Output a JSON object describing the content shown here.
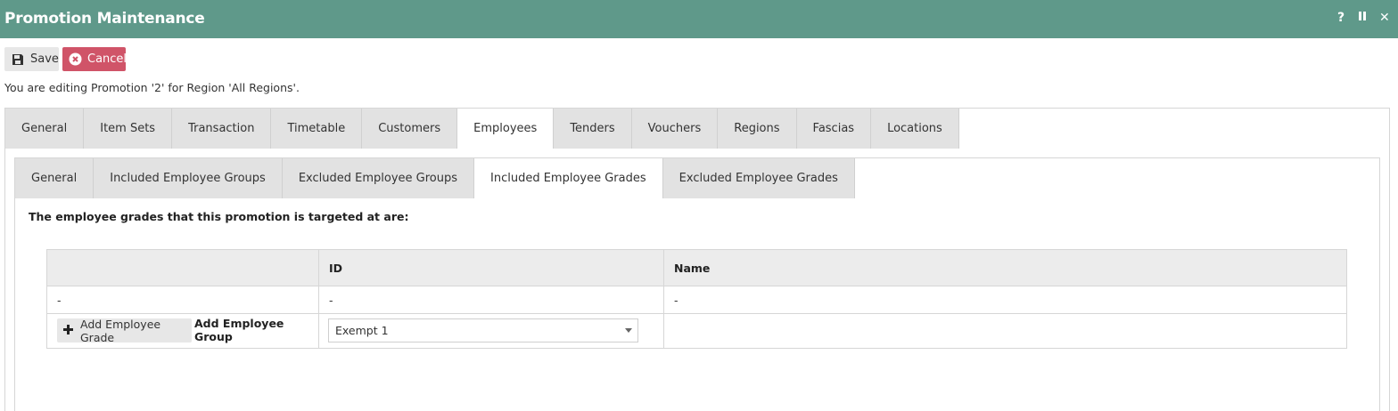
{
  "window": {
    "title": "Promotion Maintenance",
    "controls": {
      "help": "?",
      "pause": "⏸",
      "close": "✕"
    }
  },
  "toolbar": {
    "save_label": "Save",
    "cancel_label": "Cancel"
  },
  "info_text": "You are editing Promotion '2' for Region 'All Regions'.",
  "tabs": [
    "General",
    "Item Sets",
    "Transaction",
    "Timetable",
    "Customers",
    "Employees",
    "Tenders",
    "Vouchers",
    "Regions",
    "Fascias",
    "Locations"
  ],
  "active_tab": "Employees",
  "subtabs": [
    "General",
    "Included Employee Groups",
    "Excluded Employee Groups",
    "Included Employee Grades",
    "Excluded Employee Grades"
  ],
  "active_subtab": "Included Employee Grades",
  "heading": "The employee grades that this promotion is targeted at are:",
  "grid": {
    "columns": [
      "",
      "ID",
      "Name"
    ],
    "rows": [
      [
        "-",
        "-",
        "-"
      ]
    ],
    "add_button_label": "Add Employee Grade",
    "add_label": "Add Employee Group",
    "select_value": "Exempt 1"
  },
  "colors": {
    "titlebar": "#5f998a",
    "cancel": "#d05468"
  }
}
